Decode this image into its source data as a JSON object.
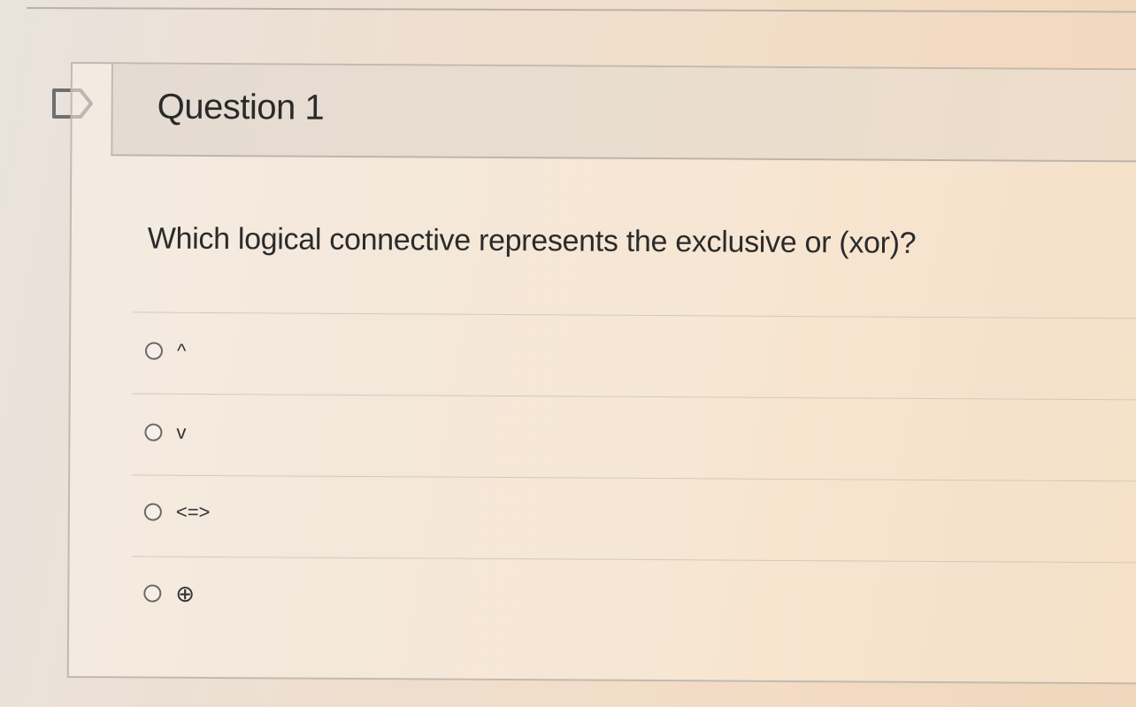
{
  "question": {
    "flag_icon": "flag-outline-icon",
    "title": "Question 1",
    "prompt": "Which logical connective represents the exclusive or (xor)?",
    "answers": [
      {
        "label": "^",
        "selected": false
      },
      {
        "label": "v",
        "selected": false
      },
      {
        "label": "<=>",
        "selected": false
      },
      {
        "label": "⊕",
        "selected": false
      }
    ]
  },
  "colors": {
    "card_border": "#c2bab0",
    "header_bg": "#e6dbd0",
    "text": "#2a2a2a",
    "radio_border": "#6a6a6a"
  }
}
